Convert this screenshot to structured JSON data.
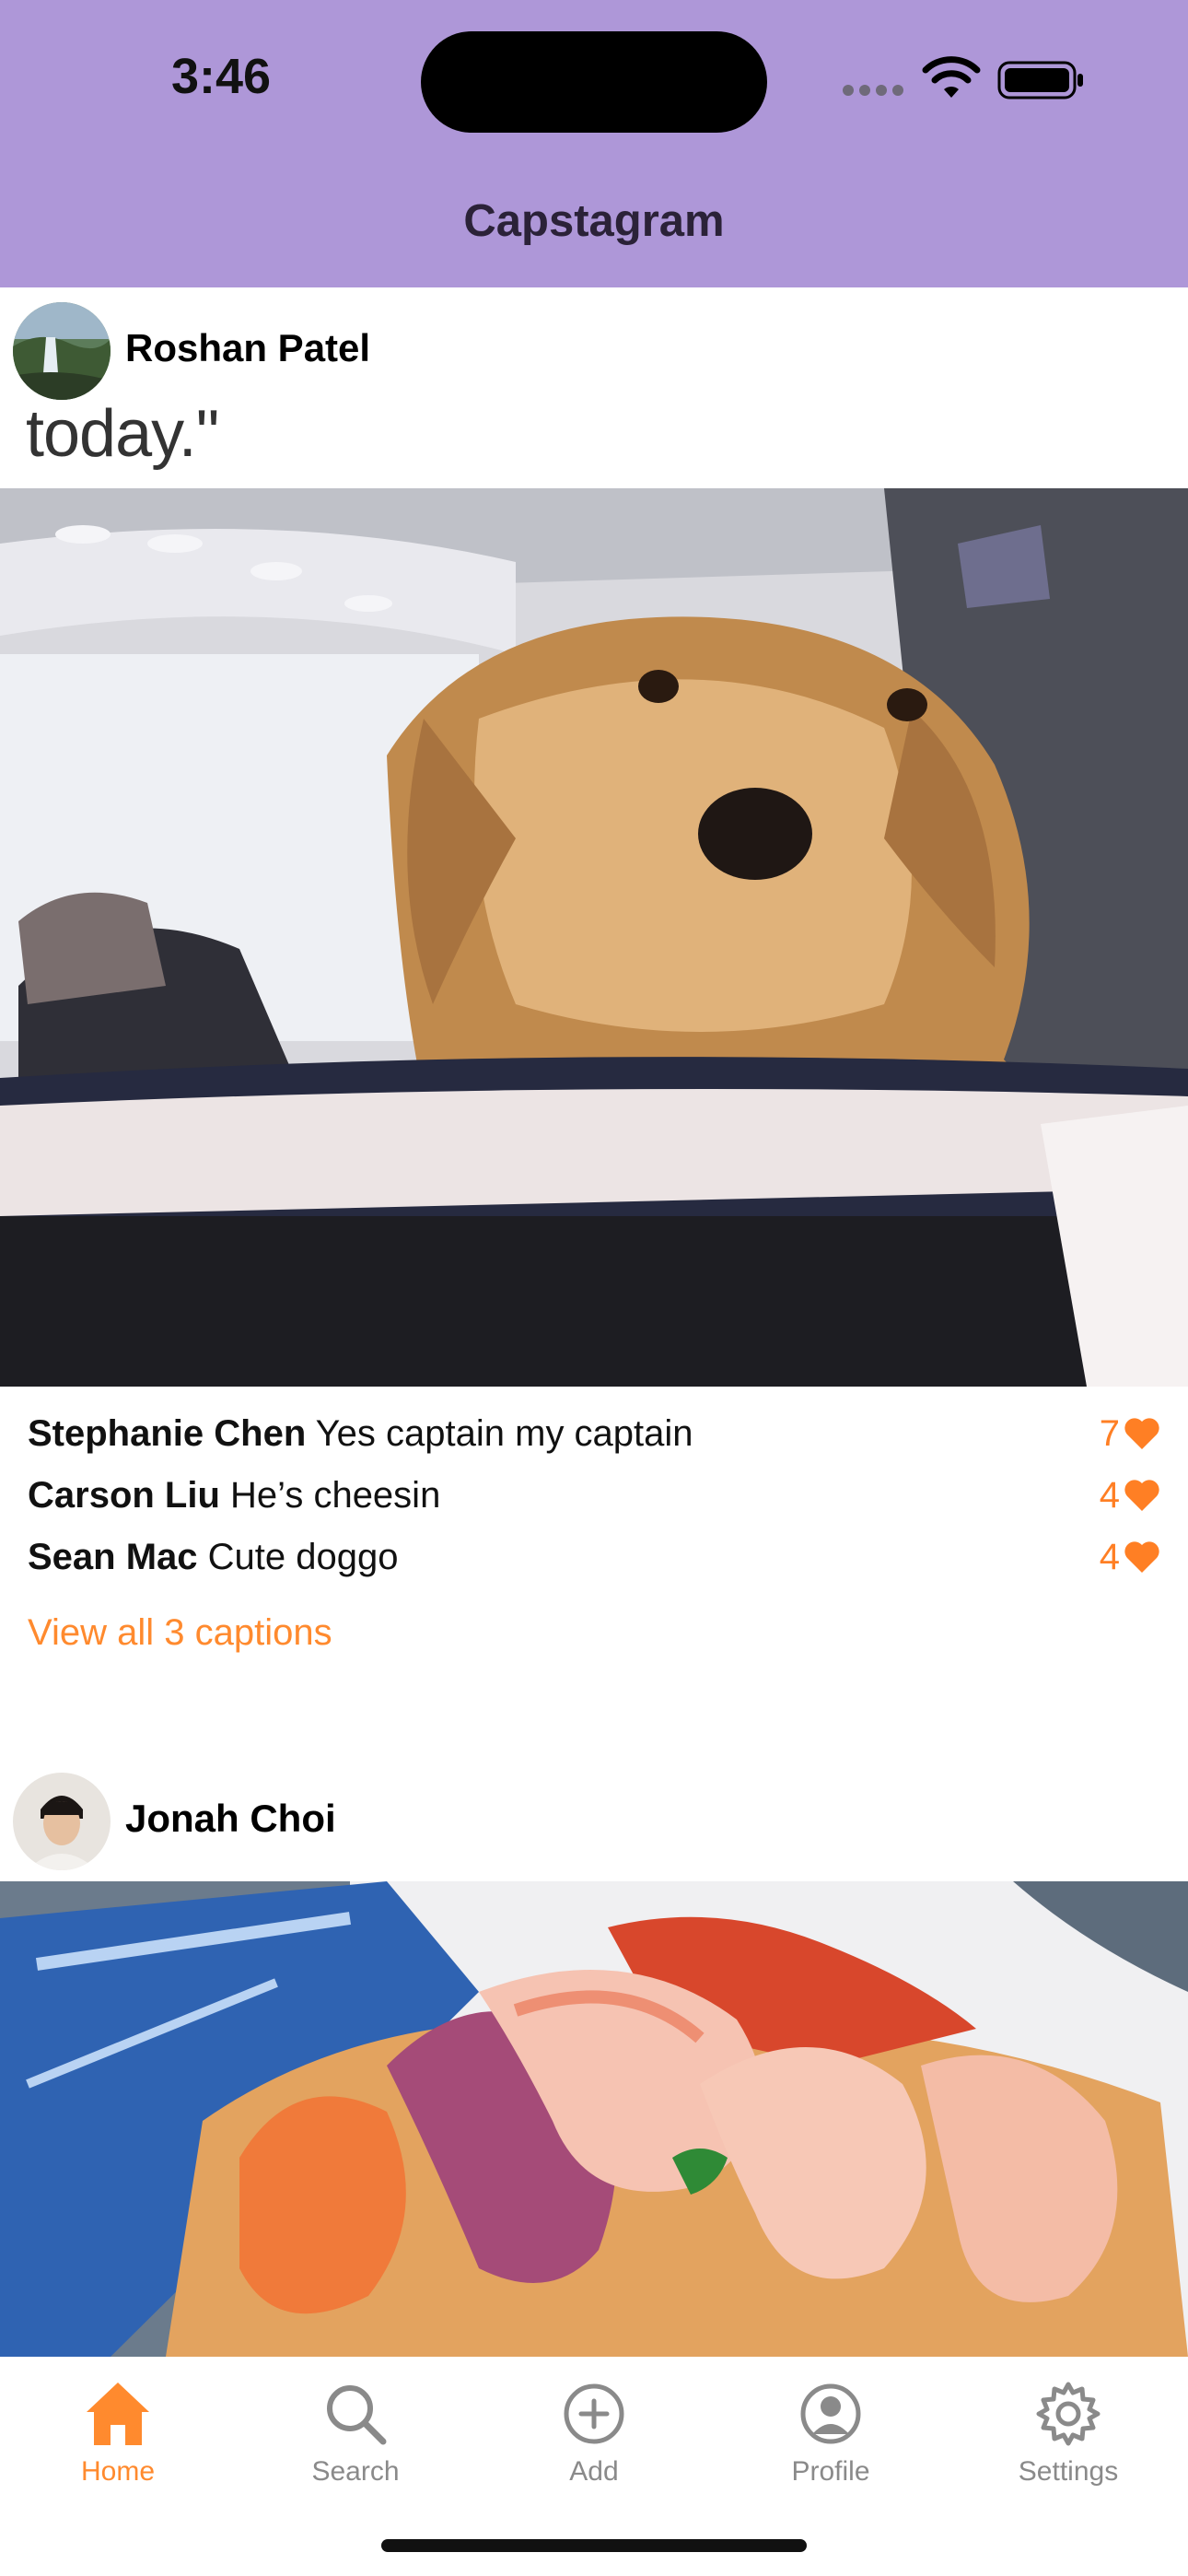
{
  "status_bar": {
    "time": "3:46"
  },
  "header": {
    "title": "Capstagram"
  },
  "posts": [
    {
      "author": "Roshan Patel",
      "overlay_text": "today.\"",
      "captions": [
        {
          "user": "Stephanie Chen",
          "text": "Yes captain my captain",
          "likes": "7"
        },
        {
          "user": "Carson Liu",
          "text": "He’s cheesin",
          "likes": "4"
        },
        {
          "user": "Sean Mac",
          "text": "Cute doggo",
          "likes": "4"
        }
      ],
      "view_all": "View all 3 captions"
    },
    {
      "author": "Jonah Choi"
    }
  ],
  "tabbar": {
    "items": [
      {
        "label": "Home",
        "icon": "house-icon",
        "active": true
      },
      {
        "label": "Search",
        "icon": "magnifier-icon",
        "active": false
      },
      {
        "label": "Add",
        "icon": "plus-circle-icon",
        "active": false
      },
      {
        "label": "Profile",
        "icon": "person-circle-icon",
        "active": false
      },
      {
        "label": "Settings",
        "icon": "gear-icon",
        "active": false
      }
    ]
  },
  "colors": {
    "header_bg": "#ae97d8",
    "accent": "#ff8a2e",
    "inactive": "#8a8a8a"
  }
}
